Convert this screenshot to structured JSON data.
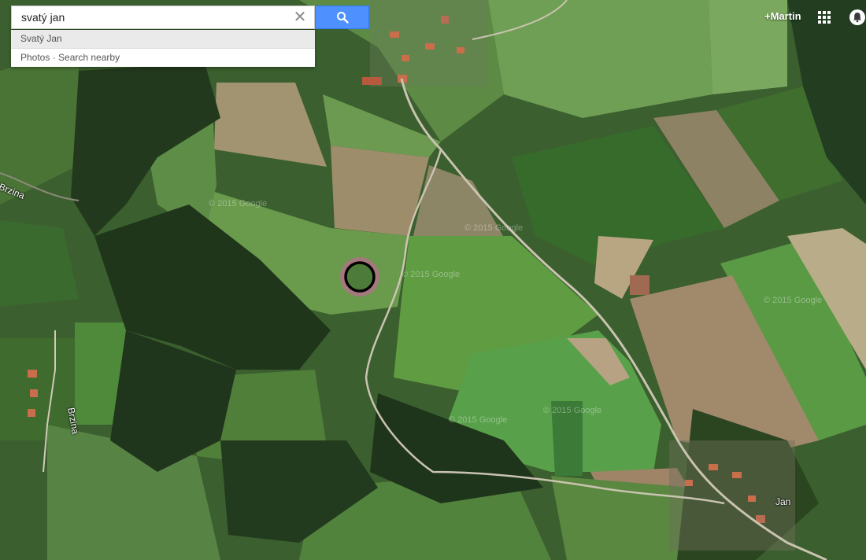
{
  "search": {
    "query": "svatý jan",
    "clear_icon": "close-icon",
    "button_icon": "search-icon"
  },
  "suggestions": [
    {
      "label": "Svatý Jan"
    },
    {
      "label": "Photos · Search nearby"
    }
  ],
  "header": {
    "user_label": "+Martin",
    "apps_icon": "apps-grid-icon",
    "notifications_icon": "bell-icon"
  },
  "map": {
    "labels": {
      "road_west": "Brzina",
      "road_southwest": "Brzina",
      "village_southeast": "Jan"
    },
    "watermarks": [
      "© 2015 Google",
      "© 2015 Google",
      "© 2015 Google",
      "© 2015 Google",
      "© 2015 Google",
      "© 2015 Google"
    ],
    "marker_color": "#e754b5"
  }
}
